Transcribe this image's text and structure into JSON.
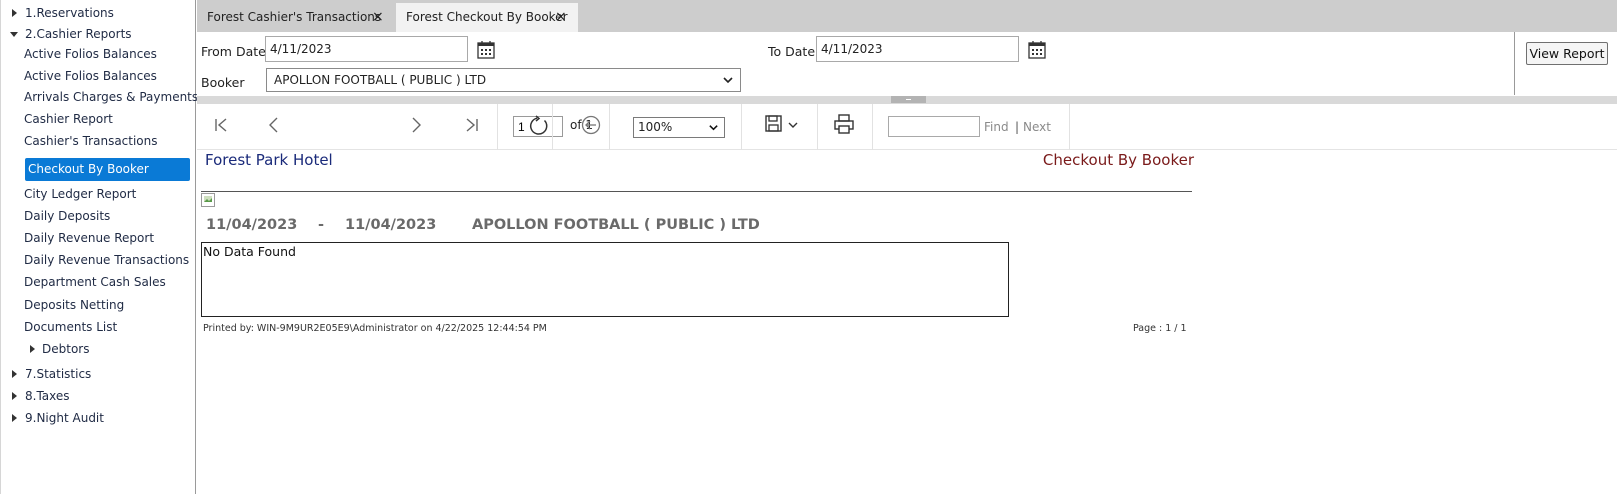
{
  "sidebar": {
    "groups": [
      {
        "label": "1.Reservations",
        "expanded": false
      },
      {
        "label": "2.Cashier Reports",
        "expanded": true
      },
      {
        "label": "7.Statistics",
        "expanded": false
      },
      {
        "label": "8.Taxes",
        "expanded": false
      },
      {
        "label": "9.Night Audit",
        "expanded": false
      }
    ],
    "cashier_items": [
      "Active Folios Balances",
      "Active Folios Balances",
      "Arrivals Charges & Payments",
      "Cashier Report",
      "Cashier's Transactions",
      "Checkout By Booker",
      "City Ledger Report",
      "Daily Deposits",
      "Daily Revenue Report",
      "Daily Revenue Transactions",
      "Department Cash Sales",
      "Deposits Netting",
      "Documents List"
    ],
    "selected_item": "Checkout By Booker",
    "debtors_label": "Debtors"
  },
  "tabs": [
    {
      "label": "Forest Cashier's Transactions",
      "close": "×",
      "active": false
    },
    {
      "label": "Forest Checkout By Booker",
      "close": "×",
      "active": true
    }
  ],
  "params": {
    "from_date_label": "From Date",
    "from_date_value": "4/11/2023",
    "to_date_label": "To Date",
    "to_date_value": "4/11/2023",
    "booker_label": "Booker",
    "booker_value": "APOLLON FOOTBALL ( PUBLIC ) LTD",
    "view_report_label": "View Report"
  },
  "toolbar": {
    "page_value": "1",
    "of_pages": "of 1",
    "zoom_value": "100%",
    "find_label": "Find",
    "next_separator": "|",
    "next_label": "Next"
  },
  "report": {
    "hotel_name": "Forest Park Hotel",
    "title": "Checkout By Booker",
    "from_date": "11/04/2023",
    "dash": "-",
    "to_date": "11/04/2023",
    "booker": "APOLLON FOOTBALL ( PUBLIC ) LTD",
    "no_data": "No Data Found",
    "printed_by": "Printed by: WIN-9M9UR2E05E9\\Administrator on 4/22/2025 12:44:54 PM",
    "page_info": "Page : 1  / 1"
  },
  "colors": {
    "selection": "#0a7ad6",
    "hotel_name": "#1a2a7a",
    "report_title": "#7a1a1a",
    "tabbar": "#cdcdcd"
  }
}
